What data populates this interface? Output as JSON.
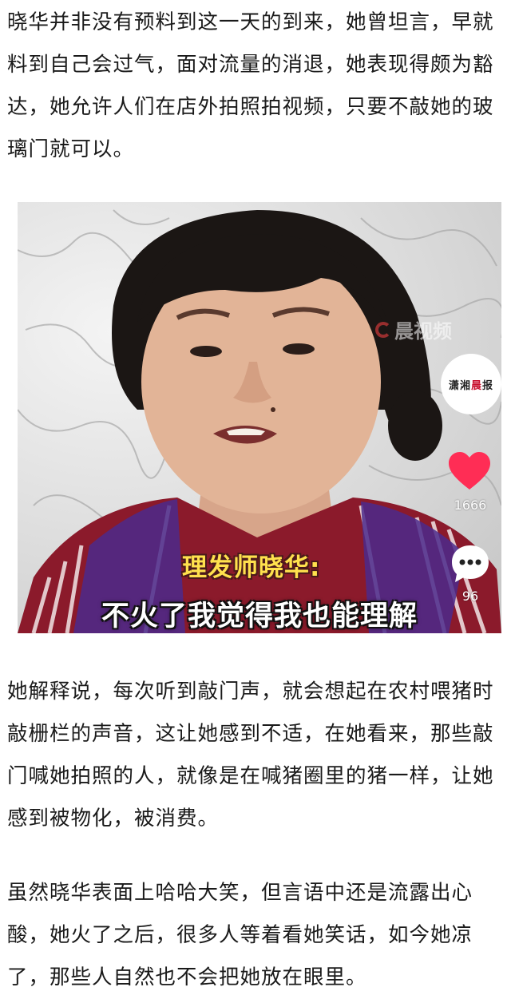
{
  "article": {
    "paragraph_1": "晓华并非没有预料到这一天的到来，她曾坦言，早就料到自己会过气，面对流量的消退，她表现得颇为豁达，她允许人们在店外拍照拍视频，只要不敲她的玻璃门就可以。",
    "paragraph_2": "她解释说，每次听到敲门声，就会想起在农村喂猪时敲栅栏的声音，这让她感到不适，在她看来，那些敲门喊她拍照的人，就像是在喊猪圈里的猪一样，让她感到被物化，被消费。",
    "paragraph_3": "虽然晓华表面上哈哈大笑，但言语中还是流露出心酸，她火了之后，很多人等着看她笑话，如今她凉了，那些人自然也不会把她放在眼里。"
  },
  "video_frame": {
    "watermark_text": "晨视频",
    "badge": {
      "part1": "潇湘",
      "part2": "晨",
      "part3": "报"
    },
    "like_count": "1666",
    "comment_count": "96",
    "caption_name": "理发师晓华:",
    "caption_line": "不火了我觉得我也能理解",
    "colors": {
      "like": "#ff2d55",
      "caption_name": "#ffe14d",
      "badge_highlight": "#c8102e"
    }
  }
}
